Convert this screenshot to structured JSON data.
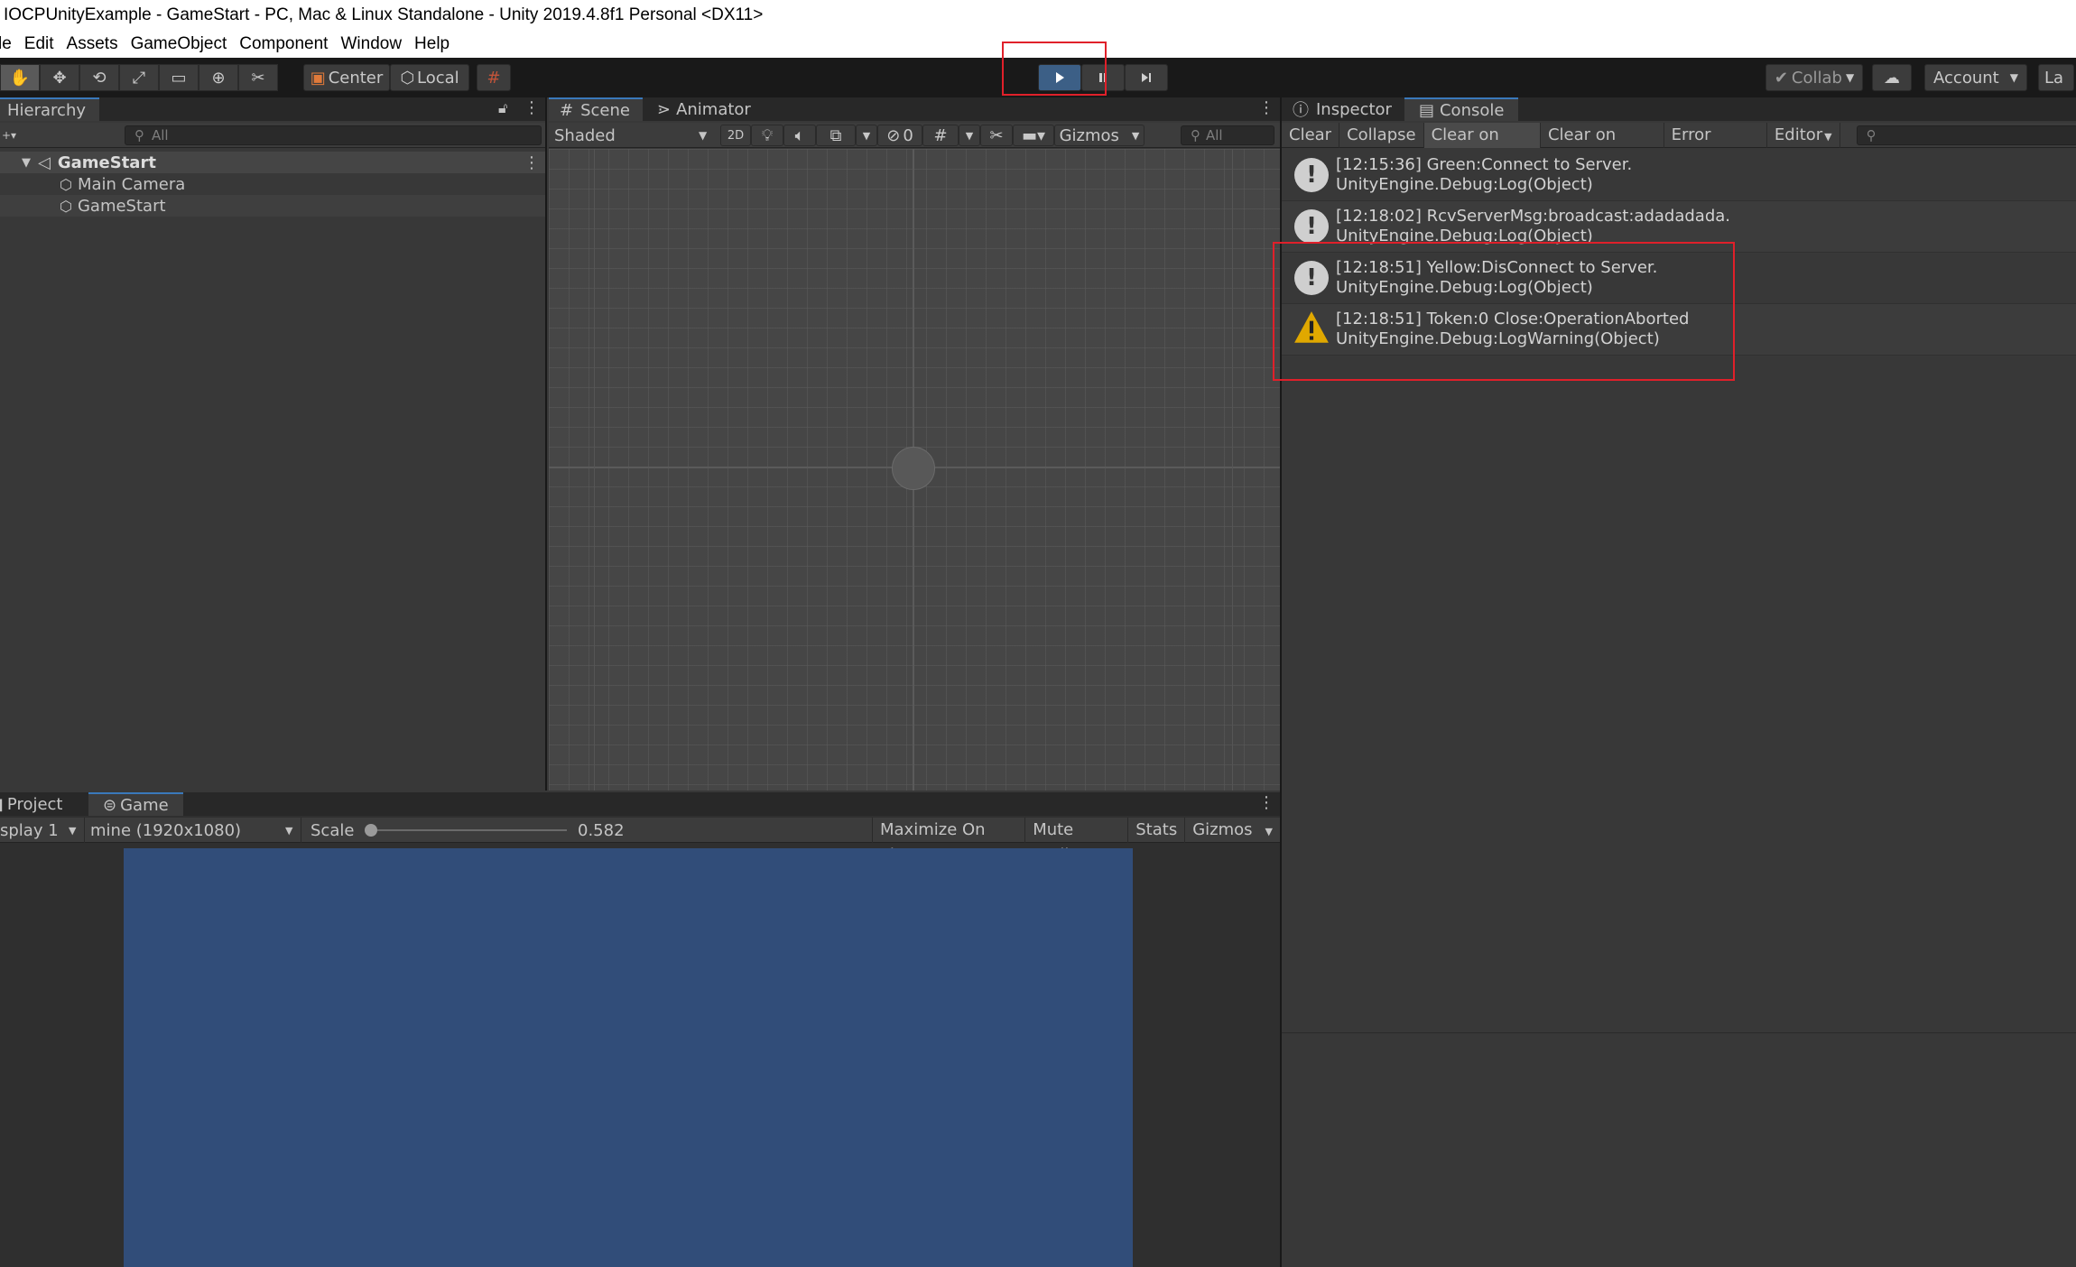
{
  "window": {
    "title": "IOCPUnityExample - GameStart - PC, Mac & Linux Standalone - Unity 2019.4.8f1 Personal <DX11>"
  },
  "menu": [
    "le",
    "Edit",
    "Assets",
    "GameObject",
    "Component",
    "Window",
    "Help"
  ],
  "toolbar": {
    "pivot_label": "Center",
    "space_label": "Local",
    "collab_label": "Collab",
    "account_label": "Account",
    "layers_label": "La"
  },
  "hierarchy": {
    "tab": "Hierarchy",
    "search_placeholder": "All",
    "scene_name": "GameStart",
    "items": [
      "Main Camera",
      "GameStart"
    ]
  },
  "scene_view": {
    "tabs": [
      "Scene",
      "Animator"
    ],
    "shading": "Shaded",
    "mode_2d": "2D",
    "hidden_count": "0",
    "gizmos": "Gizmos",
    "search_placeholder": "All"
  },
  "right_panel": {
    "tabs": [
      "Inspector",
      "Console"
    ],
    "console_buttons": [
      "Clear",
      "Collapse",
      "Clear on Play",
      "Clear on Build",
      "Error Pause",
      "Editor"
    ],
    "logs": [
      {
        "type": "info",
        "line1": "[12:15:36] Green:Connect to Server.",
        "line2": "UnityEngine.Debug:Log(Object)"
      },
      {
        "type": "info",
        "line1": "[12:18:02] RcvServerMsg:broadcast:adadadada.",
        "line2": "UnityEngine.Debug:Log(Object)"
      },
      {
        "type": "info",
        "line1": "[12:18:51] Yellow:DisConnect to Server.",
        "line2": "UnityEngine.Debug:Log(Object)"
      },
      {
        "type": "warning",
        "line1": "[12:18:51] Token:0 Close:OperationAborted",
        "line2": "UnityEngine.Debug:LogWarning(Object)"
      }
    ]
  },
  "game_view": {
    "tabs": [
      "Project",
      "Game"
    ],
    "display": "splay 1",
    "resolution": "mine (1920x1080)",
    "scale_label": "Scale",
    "scale_value": "0.582",
    "buttons": [
      "Maximize On Play",
      "Mute Audio",
      "Stats",
      "Gizmos"
    ]
  },
  "colors": {
    "accent": "#3a79bb",
    "game_background": "#314d79",
    "highlight_box": "#e0202a",
    "warning": "#e0a800"
  }
}
